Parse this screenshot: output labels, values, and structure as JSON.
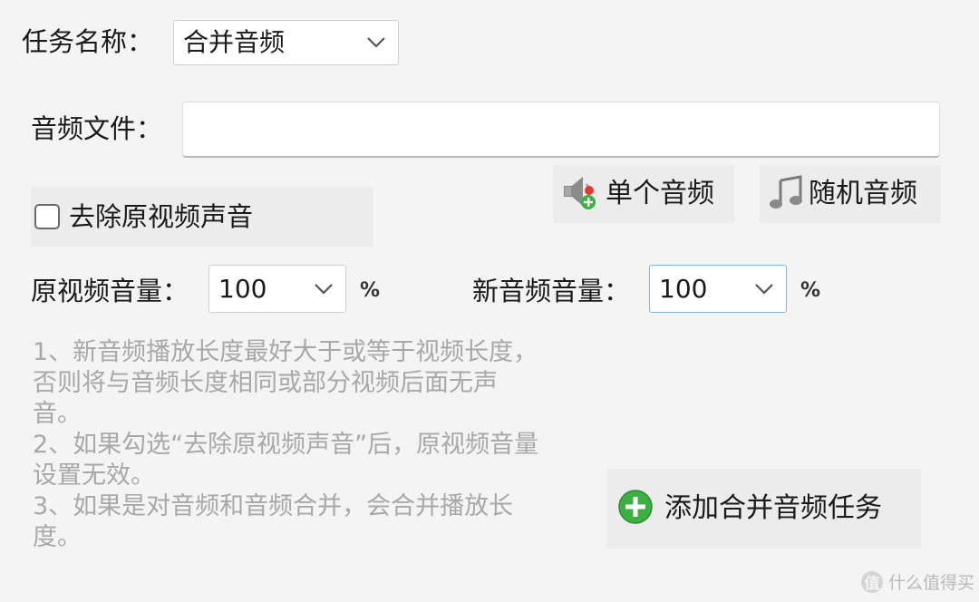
{
  "task": {
    "label": "任务名称：",
    "selected": "合并音频"
  },
  "audio_file": {
    "label": "音频文件：",
    "value": ""
  },
  "buttons": {
    "single_audio": "单个音频",
    "random_audio": "随机音频",
    "add_task": "添加合并音频任务"
  },
  "remove_original": {
    "label": "去除原视频声音",
    "checked": false
  },
  "original_volume": {
    "label": "原视频音量：",
    "value": "100",
    "unit": "%"
  },
  "new_volume": {
    "label": "新音频音量：",
    "value": "100",
    "unit": "%"
  },
  "notes": [
    "1、新音频播放长度最好大于或等于视频长度，否则将与音频长度相同或部分视频后面无声音。",
    "2、如果勾选“去除原视频声音”后，原视频音量设置无效。",
    "3、如果是对音频和音频合并，会合并播放长度。"
  ],
  "watermark": {
    "glyph": "值",
    "text": "什么值得买"
  },
  "colors": {
    "background": "#f4f4f4",
    "button_bg": "#ececec",
    "focus_border": "#7fb4e6",
    "notes_text": "#a8a8a8",
    "add_icon_green": "#3cb043"
  }
}
